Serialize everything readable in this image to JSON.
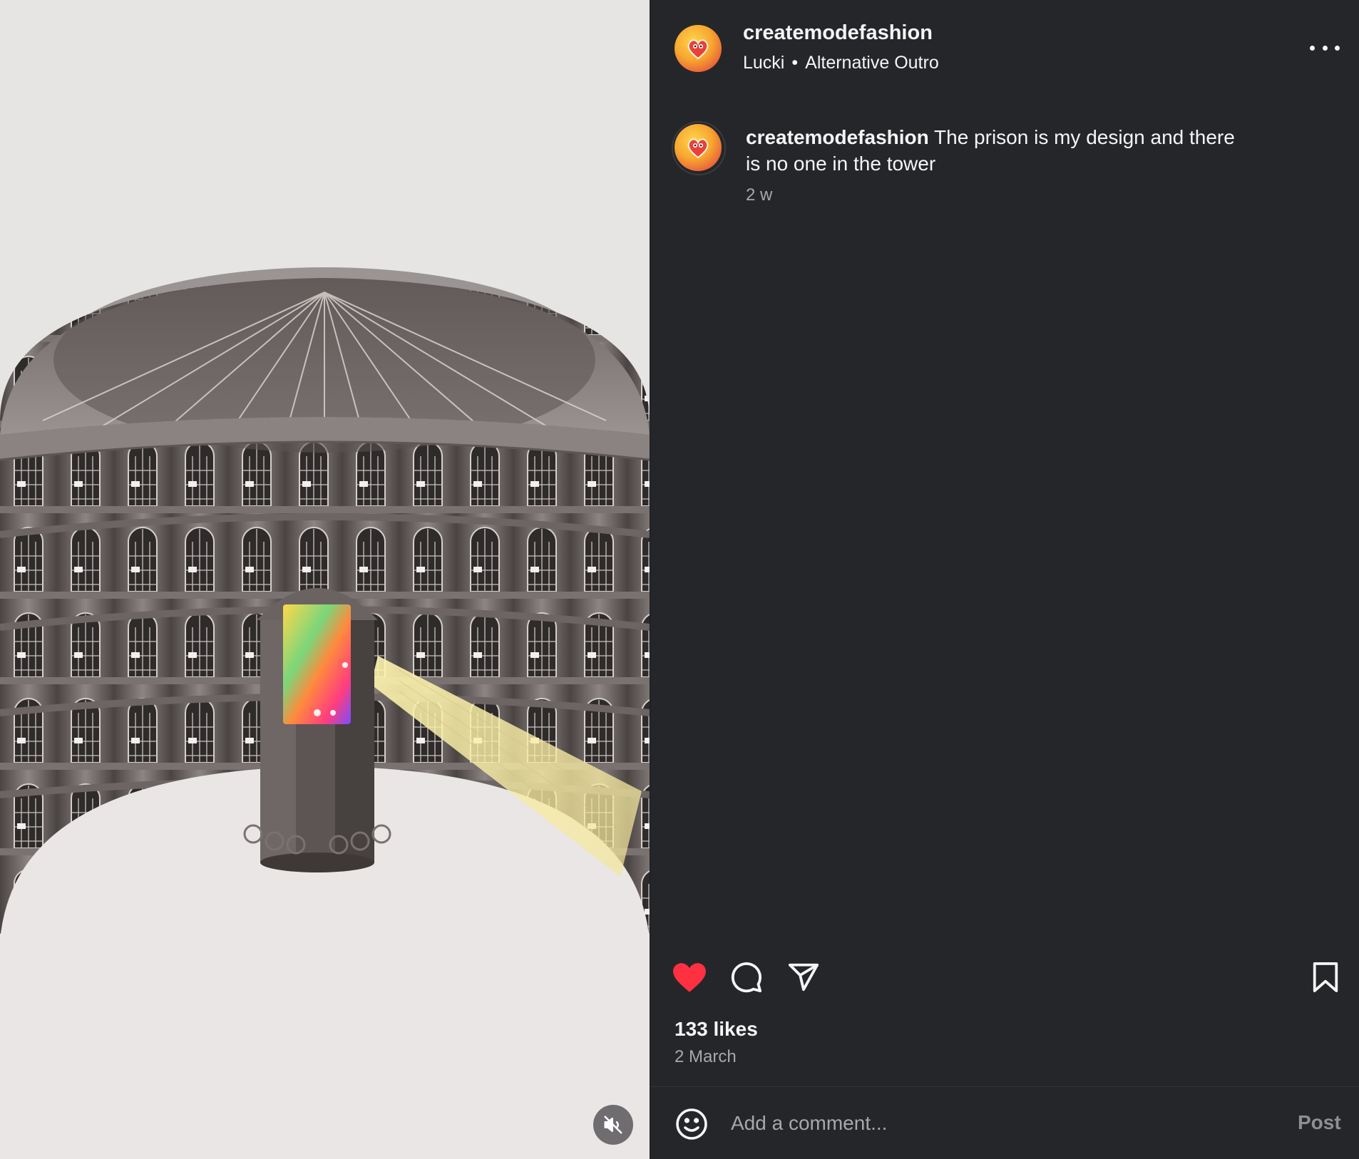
{
  "post": {
    "username": "createmodefashion",
    "audio": {
      "artist": "Lucki",
      "separator": "•",
      "track": "Alternative Outro"
    },
    "caption": {
      "username": "createmodefashion",
      "text": "The prison is my design and there is no one in the tower",
      "age": "2 w"
    },
    "likes": "133 likes",
    "date": "2 March",
    "liked": true
  },
  "comment": {
    "placeholder": "Add a comment...",
    "post_label": "Post"
  },
  "icons": {
    "more": "more-options-icon",
    "like": "heart-icon",
    "comment": "comment-icon",
    "share": "send-icon",
    "save": "bookmark-icon",
    "emoji": "emoji-icon",
    "mute": "speaker-muted-icon"
  },
  "colors": {
    "panel_bg": "#25262a",
    "like_red": "#ff3040",
    "secondary_text": "#a8a8a8"
  }
}
